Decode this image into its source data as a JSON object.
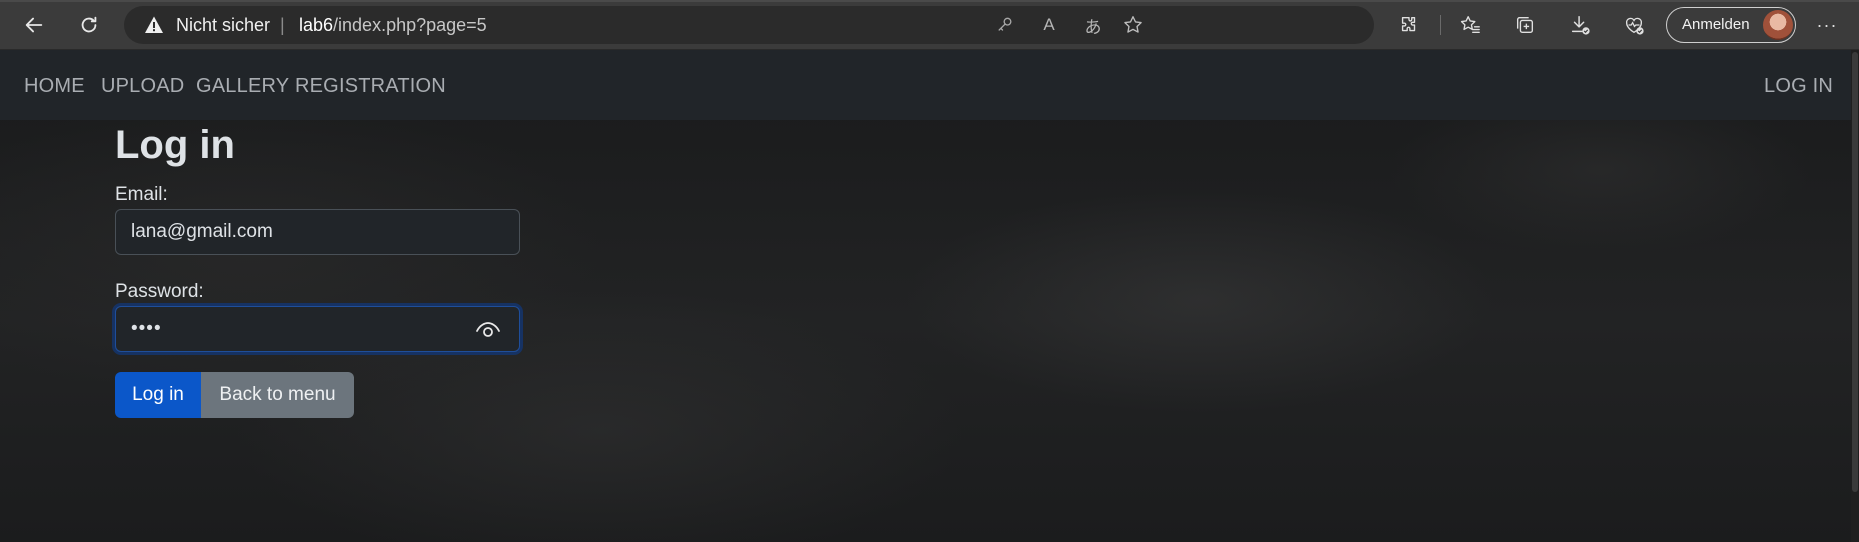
{
  "browser": {
    "security_label": "Nicht sicher",
    "separator": "|",
    "url_host": "lab6",
    "url_path": "/index.php?page=5",
    "signin_label": "Anmelden",
    "read_aloud_glyph": "A",
    "translate_glyph": "あ",
    "more_glyph": "···",
    "icons": [
      "back-icon",
      "refresh-icon",
      "warning-icon",
      "key-icon",
      "read-aloud-icon",
      "translate-icon",
      "favorite-star-icon",
      "extensions-icon",
      "favorites-icon",
      "collections-icon",
      "downloads-icon",
      "browser-essentials-icon",
      "more-icon"
    ]
  },
  "navbar": {
    "left_links": [
      "HOME",
      "UPLOAD",
      "GALLERY",
      "REGISTRATION"
    ],
    "right_link": "LOG IN"
  },
  "form": {
    "title": "Log in",
    "email_label": "Email:",
    "email_value": "lana@gmail.com",
    "password_label": "Password:",
    "password_masked": "••••",
    "login_button": "Log in",
    "back_button": "Back to menu"
  },
  "colors": {
    "primary": "#0b57c9",
    "secondary": "#6c757d",
    "navbar_bg": "#212529",
    "chrome_bg": "#3b3b3b"
  }
}
